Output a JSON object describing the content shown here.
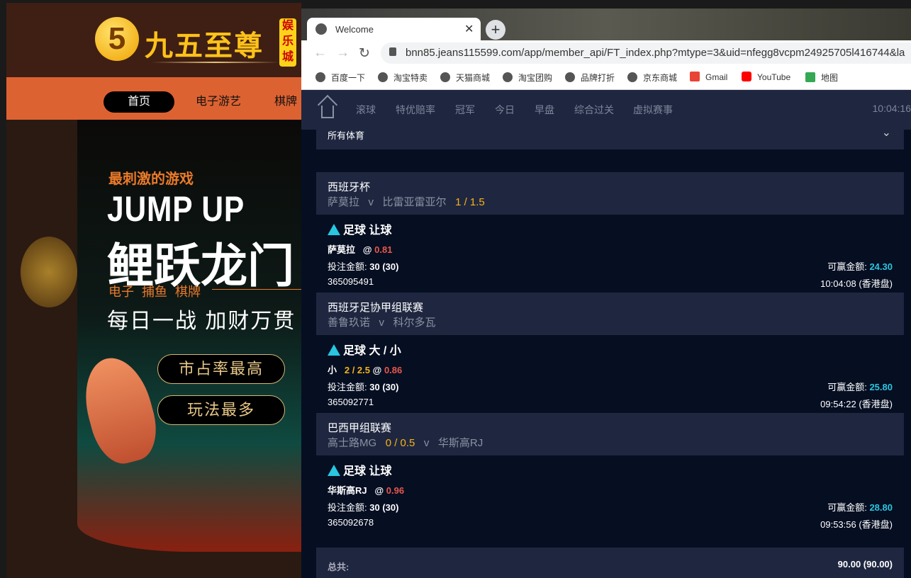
{
  "background_site": {
    "logo_text": "九五至尊",
    "logo_badge": "娱乐城",
    "logo_mark": "5",
    "nav": [
      "首页",
      "电子游艺",
      "棋牌"
    ],
    "banner": {
      "tagline": "最刺激的游戏",
      "headline_en": "JUMP UP",
      "headline_cn": "鲤跃龙门",
      "categories": "电子  捕鱼  棋牌",
      "slogan": "每日一战  加财万贯",
      "buttons": [
        "市占率最高",
        "玩法最多"
      ]
    }
  },
  "browser": {
    "tab_title": "Welcome",
    "url": "bnn85.jeans115599.com/app/member_api/FT_index.php?mtype=3&uid=nfegg8vcpm24925705l416744&la",
    "bookmarks": [
      "百度一下",
      "淘宝特卖",
      "天猫商城",
      "淘宝团购",
      "品牌打折",
      "京东商城",
      "Gmail",
      "YouTube",
      "地图"
    ]
  },
  "app": {
    "nav": [
      "滚球",
      "特优赔率",
      "冠军",
      "今日",
      "早盘",
      "综合过关",
      "虚拟赛事"
    ],
    "clock": "10:04:16",
    "sport_filter": "所有体育",
    "stake_label": "投注金额:",
    "win_label": "可赢金额:",
    "bets": [
      {
        "league": "西班牙杯",
        "home": "萨莫拉",
        "v": "v",
        "away": "比雷亚雷亚尔",
        "handicap": "1 / 1.5",
        "market": "足球 让球",
        "pick": "萨莫拉",
        "odds_prefix": "@",
        "odds": "0.81",
        "stake": "30 (30)",
        "win": "24.30",
        "id": "365095491",
        "time": "10:04:08 (香港盘)"
      },
      {
        "league": "西班牙足协甲组联赛",
        "home": "善鲁玖诺",
        "v": "v",
        "away": "科尔多瓦",
        "market": "足球 大 / 小",
        "pick": "小",
        "pick_line": "2 / 2.5",
        "odds_prefix": "@",
        "odds": "0.86",
        "stake": "30 (30)",
        "win": "25.80",
        "id": "365092771",
        "time": "09:54:22 (香港盘)"
      },
      {
        "league": "巴西甲组联赛",
        "home": "高士路MG",
        "handicap": "0 / 0.5",
        "v": "v",
        "away": "华斯高RJ",
        "market": "足球 让球",
        "pick": "华斯高RJ",
        "odds_prefix": "@",
        "odds": "0.96",
        "stake": "30 (30)",
        "win": "28.80",
        "id": "365092678",
        "time": "09:53:56 (香港盘)"
      }
    ],
    "total_label": "总共:",
    "total_value": "90.00 (90.00)"
  },
  "colors": {
    "nav_bg": "#1f2740",
    "page_bg": "#060e22",
    "odds": "#e8574a",
    "handicap": "#f6b21a",
    "win": "#29c6e0"
  }
}
